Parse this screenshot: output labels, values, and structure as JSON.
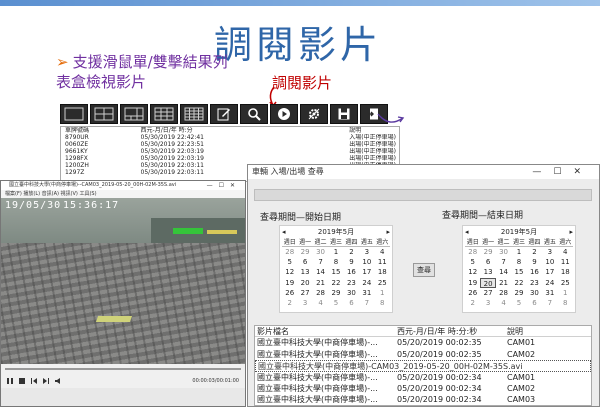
{
  "slide": {
    "title": "調閱影片",
    "bullet": "支援滑鼠單/雙擊結果列表盒檢視影片",
    "callout": "調閱影片"
  },
  "colors": {
    "title": "#2f66a8",
    "bullet": "#7030a0",
    "callout": "#c00000",
    "toolbar": "#2b2b2b"
  },
  "toolbar": {
    "buttons": [
      {
        "name": "layout-1-icon"
      },
      {
        "name": "layout-4-icon"
      },
      {
        "name": "layout-6-icon"
      },
      {
        "name": "layout-9-icon"
      },
      {
        "name": "layout-16-icon"
      },
      {
        "name": "edit-icon"
      },
      {
        "name": "search-icon"
      },
      {
        "name": "play-icon"
      },
      {
        "name": "settings-icon"
      },
      {
        "name": "save-icon"
      },
      {
        "name": "exit-icon"
      }
    ]
  },
  "main_list": {
    "columns": [
      "車牌號碼",
      "西元-月/日/年 時:分",
      "",
      "說明"
    ],
    "rows": [
      [
        "8790UR",
        "05/30/2019 22:42:41",
        "",
        "入場(中正停車場)"
      ],
      [
        "0060ZE",
        "05/30/2019 22:23:51",
        "",
        "出場(中正停車場)"
      ],
      [
        "9661KY",
        "05/30/2019 22:03:19",
        "",
        "出場(中正停車場)"
      ],
      [
        "1298FX",
        "05/30/2019 22:03:19",
        "",
        "出場(中正停車場)"
      ],
      [
        "1200ZH",
        "05/30/2019 22:03:11",
        "",
        "出場(中正停車場)"
      ],
      [
        "1297Z",
        "05/30/2019 22:03:11",
        "",
        "出場(中正停車場)"
      ]
    ]
  },
  "video_window": {
    "title": "國立臺中科技大學(中商停車場)--CAM03_2019-05-20_00H-02M-35S.avi",
    "menu": "檔案(F)   播放(L)   音訊(A)   視訊(V)   工具(S)",
    "osd_date": "19/05/30",
    "osd_time": "15:36:17",
    "time_display": "00:00:03/00:01:00"
  },
  "dialog": {
    "title": "車輛 入場/出場 查尋",
    "start_label": "查尋期間—開始日期",
    "end_label": "查尋期間—結束日期",
    "query_button": "查尋",
    "calendar": {
      "month": "2019年5月",
      "weekdays": [
        "週日",
        "週一",
        "週二",
        "週三",
        "週四",
        "週五",
        "週六"
      ],
      "weeks": [
        [
          "28",
          "29",
          "30",
          "1",
          "2",
          "3",
          "4"
        ],
        [
          "5",
          "6",
          "7",
          "8",
          "9",
          "10",
          "11"
        ],
        [
          "12",
          "13",
          "14",
          "15",
          "16",
          "17",
          "18"
        ],
        [
          "19",
          "20",
          "21",
          "22",
          "23",
          "24",
          "25"
        ],
        [
          "26",
          "27",
          "28",
          "29",
          "30",
          "31",
          "1"
        ],
        [
          "2",
          "3",
          "4",
          "5",
          "6",
          "7",
          "8"
        ]
      ]
    },
    "results": {
      "columns": [
        "影片檔名",
        "西元-月/日/年 時:分:秒",
        "說明"
      ],
      "rows": [
        {
          "name": "國立臺中科技大學(中商停車場)-...",
          "time": "05/20/2019 00:02:35",
          "note": "CAM01"
        },
        {
          "name": "國立臺中科技大學(中商停車場)-...",
          "time": "05/20/2019 00:02:35",
          "note": "CAM02"
        },
        {
          "name": "國立臺中科技大學(中商停車場)-CAM03_2019-05-20_00H-02M-35S.avi",
          "time": "",
          "note": ""
        },
        {
          "name": "國立臺中科技大學(中商停車場)-...",
          "time": "05/20/2019 00:02:34",
          "note": "CAM01"
        },
        {
          "name": "國立臺中科技大學(中商停車場)-...",
          "time": "05/20/2019 00:02:34",
          "note": "CAM02"
        },
        {
          "name": "國立臺中科技大學(中商停車場)-...",
          "time": "05/20/2019 00:02:34",
          "note": "CAM03"
        }
      ]
    }
  }
}
